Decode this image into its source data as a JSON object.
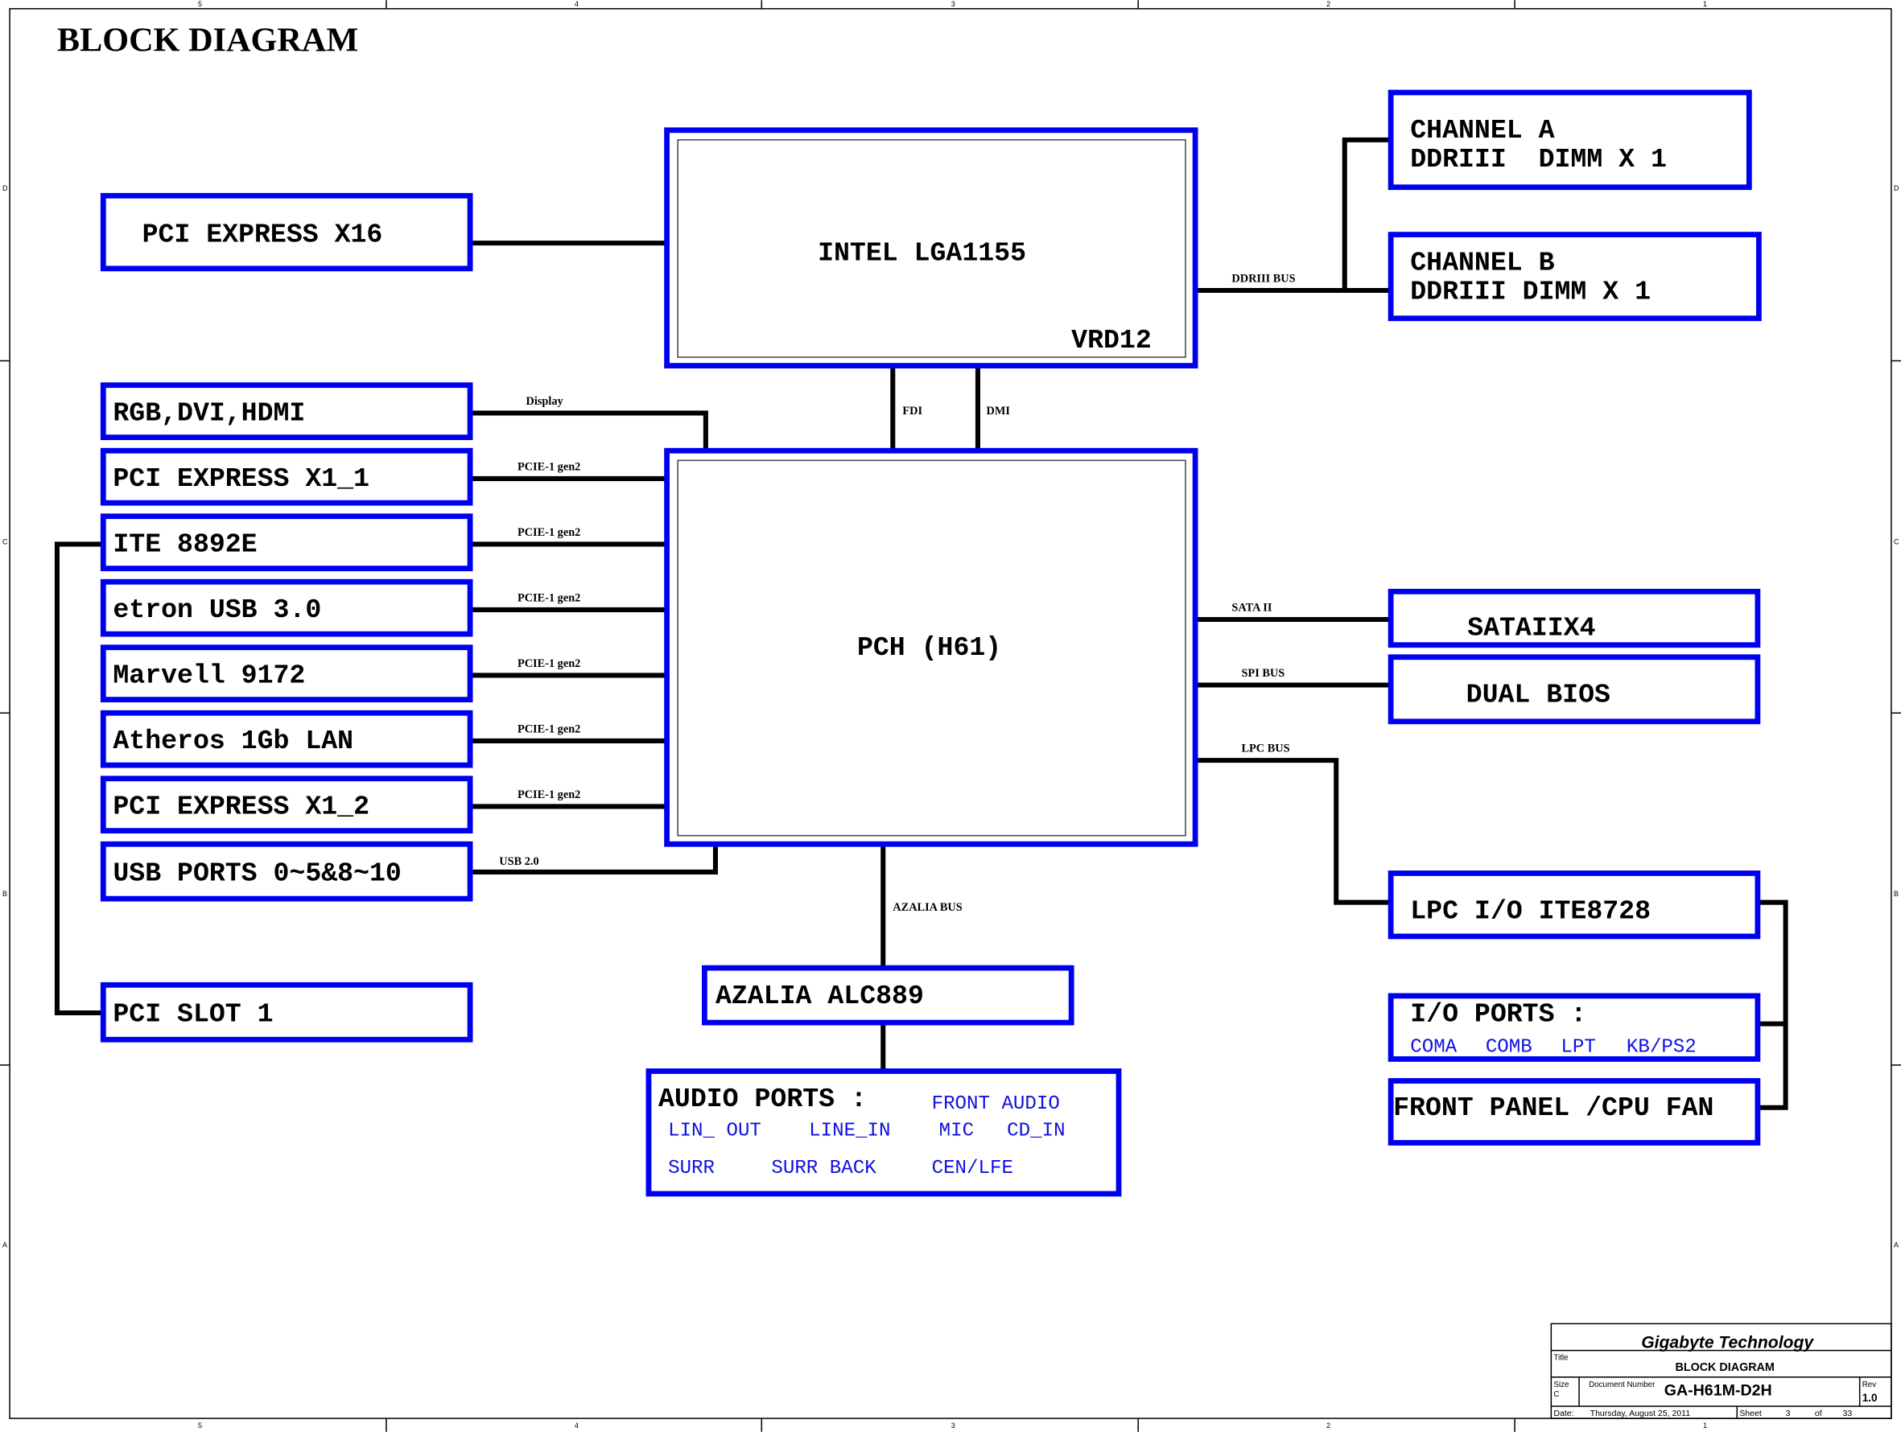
{
  "title": "BLOCK DIAGRAM",
  "frame": {
    "columns": [
      "5",
      "4",
      "3",
      "2",
      "1"
    ],
    "rows": [
      "D",
      "C",
      "B",
      "A"
    ]
  },
  "cpu": {
    "name": "INTEL LGA1155",
    "vr": "VRD12"
  },
  "pch": {
    "name": "PCH (H61)"
  },
  "left_blocks": {
    "pcie_x16": "PCI EXPRESS X16",
    "rgb": "RGB,DVI,HDMI",
    "pcie_x1_1": "PCI EXPRESS X1_1",
    "ite": "ITE 8892E",
    "etron": "etron USB 3.0",
    "marvell": "Marvell 9172",
    "atheros": "Atheros 1Gb LAN",
    "pcie_x1_2": "PCI EXPRESS X1_2",
    "usb": "USB PORTS 0~5&8~10",
    "pci_slot": "PCI SLOT 1"
  },
  "buses": {
    "display": "Display",
    "pcie": "PCIE-1 gen2",
    "usb": "USB 2.0",
    "fdi": "FDI",
    "dmi": "DMI",
    "ddr": "DDRIII BUS",
    "sata": "SATA II",
    "spi": "SPI BUS",
    "lpc": "LPC BUS",
    "azalia": "AZALIA BUS"
  },
  "right_blocks": {
    "chan_a": [
      "CHANNEL A",
      "DDRIII  DIMM X 1"
    ],
    "chan_b": [
      "CHANNEL B",
      "DDRIII DIMM X 1"
    ],
    "sata": "SATAIIX4",
    "bios": "DUAL BIOS",
    "lpc_io": "LPC I/O ITE8728",
    "io_ports": "I/O PORTS :",
    "io_list": [
      "COMA",
      "COMB",
      "LPT",
      "KB/PS2"
    ],
    "front_panel": "FRONT PANEL /CPU FAN"
  },
  "audio": {
    "codec": "AZALIA ALC889",
    "ports_title": "AUDIO PORTS :",
    "ports": [
      "FRONT AUDIO",
      "LIN_ OUT",
      "LINE_IN",
      "MIC",
      "CD_IN",
      "SURR",
      "SURR BACK",
      "CEN/LFE"
    ]
  },
  "title_block": {
    "company": "Gigabyte Technology",
    "title_label": "Title",
    "title": "BLOCK DIAGRAM",
    "size_label": "Size",
    "size": "C",
    "doc_label": "Document Number",
    "doc": "GA-H61M-D2H",
    "rev_label": "Rev",
    "rev": "1.0",
    "date_label": "Date:",
    "date": "Thursday, August 25, 2011",
    "sheet_label": "Sheet",
    "sheet": "3",
    "of_label": "of",
    "total": "33"
  },
  "colors": {
    "block_border": "#0000f0",
    "wire": "#000000",
    "company": "#1010e0"
  }
}
